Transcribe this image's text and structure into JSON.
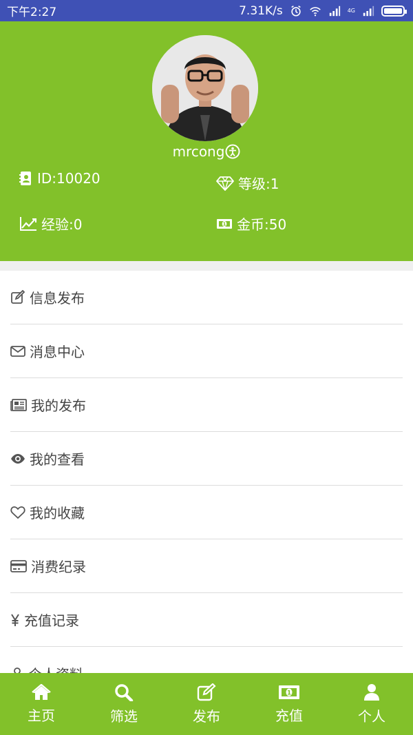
{
  "status_bar": {
    "time": "下午2:27",
    "speed": "7.31K/s",
    "network": "4G"
  },
  "profile": {
    "username": "mrcong",
    "id": "ID:10020",
    "level": "等级:1",
    "experience": "经验:0",
    "coins": "金币:50"
  },
  "menu": {
    "items": [
      {
        "label": "信息发布",
        "icon": "edit-icon"
      },
      {
        "label": "消息中心",
        "icon": "envelope-icon"
      },
      {
        "label": "我的发布",
        "icon": "newspaper-icon"
      },
      {
        "label": "我的查看",
        "icon": "eye-icon"
      },
      {
        "label": "我的收藏",
        "icon": "heart-icon"
      },
      {
        "label": "消费纪录",
        "icon": "credit-card-icon"
      },
      {
        "label": "充值记录",
        "icon": "yen-icon"
      },
      {
        "label": "个人资料",
        "icon": "user-icon"
      }
    ]
  },
  "tabbar": {
    "tabs": [
      {
        "label": "主页",
        "icon": "home-icon"
      },
      {
        "label": "筛选",
        "icon": "search-icon"
      },
      {
        "label": "发布",
        "icon": "edit-icon"
      },
      {
        "label": "充值",
        "icon": "money-icon"
      },
      {
        "label": "个人",
        "icon": "user-icon"
      }
    ]
  },
  "colors": {
    "primary": "#82c12a",
    "status_bar": "#3f51b5",
    "divider": "#dcdcdc"
  }
}
